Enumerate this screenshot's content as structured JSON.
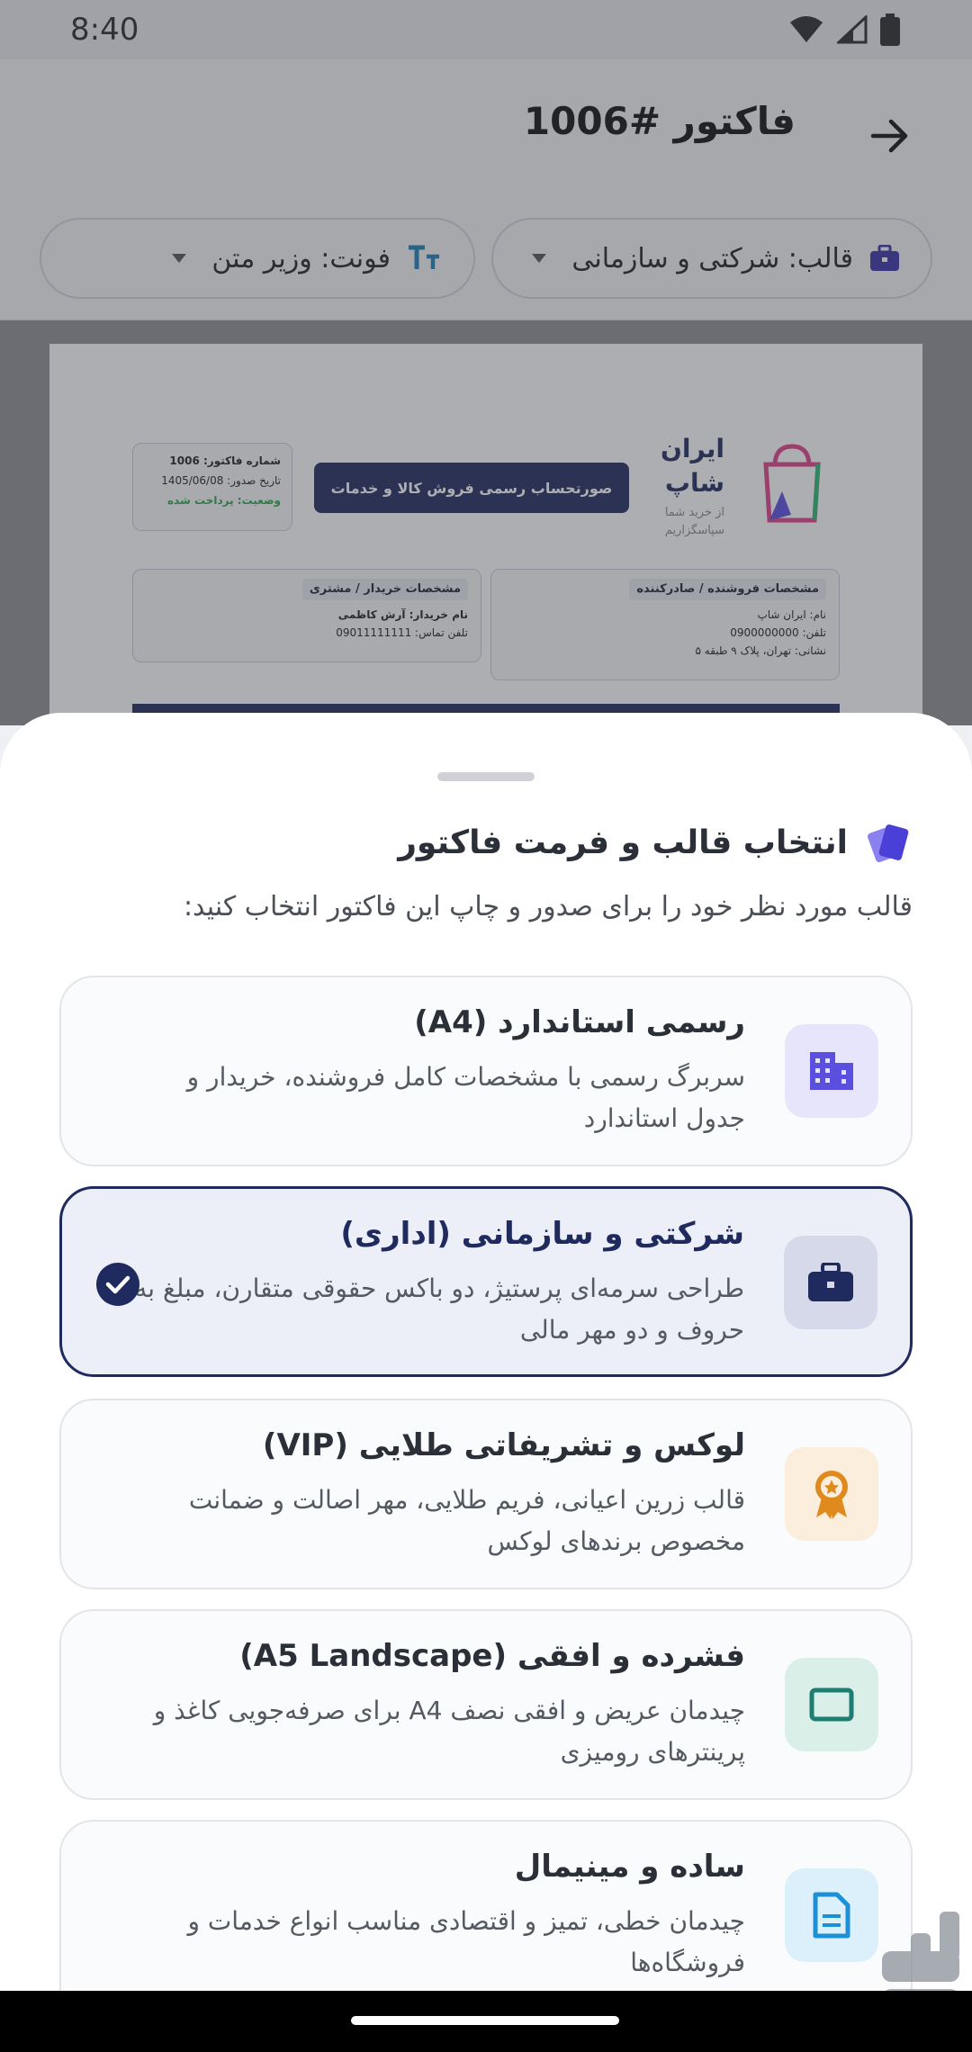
{
  "status": {
    "time": "8:40"
  },
  "app_bar": {
    "title": "فاکتور #1006",
    "template_pill": "قالب: شرکتی و سازمانی",
    "font_pill": "فونت: وزیر متن"
  },
  "preview": {
    "shop_name_1": "ایران",
    "shop_name_2": "شاپ",
    "shop_thanks_1": "از خرید شما",
    "shop_thanks_2": "سپاسگزاریم",
    "banner": "صورتحساب رسمی فروش کالا و خدمات",
    "invoice_number": "شماره فاکتور: 1006",
    "issue_date": "تاریخ صدور: 1405/06/08",
    "status": "وضعیت: پرداخت شده",
    "seller_tag": "مشخصات فروشنده / صادرکننده",
    "seller_name": "نام: ایران شاپ",
    "seller_phone": "تلفن: 0900000000",
    "seller_address": "نشانی: تهران، پلاک ۹ طبقه ۵",
    "buyer_tag": "مشخصات خریدار / مشتری",
    "buyer_name": "نام خریدار: آرش کاظمی",
    "buyer_phone": "تلفن تماس: 09011111111"
  },
  "sheet": {
    "title": "انتخاب قالب و فرمت فاکتور",
    "subtitle": "قالب مورد نظر خود را برای صدور و چاپ این فاکتور انتخاب کنید:",
    "options": [
      {
        "title": "رسمی استاندارد (A4)",
        "desc": "سربرگ رسمی با مشخصات کامل فروشنده، خریدار و جدول استاندارد",
        "icon": "building-icon"
      },
      {
        "title": "شرکتی و سازمانی (اداری)",
        "desc": "طراحی سرمه‌ای پرستیژ، دو باکس حقوقی متقارن، مبلغ به حروف و دو مهر مالی",
        "icon": "briefcase-icon",
        "selected": true
      },
      {
        "title": "لوکس و تشریفاتی طلایی (VIP)",
        "desc": "قالب زرین اعیانی، فریم طلایی، مهر اصالت و ضمانت مخصوص برندهای لوکس",
        "icon": "award-icon"
      },
      {
        "title": "فشرده و افقی (A5 Landscape)",
        "desc": "چیدمان عریض و افقی نصف A4 برای صرفه‌جویی کاغذ و پرینترهای رومیزی",
        "icon": "landscape-icon"
      },
      {
        "title": "ساده و مینیمال",
        "desc": "چیدمان خطی، تمیز و اقتصادی مناسب انواع خدمات و فروشگاه‌ها",
        "icon": "document-icon"
      }
    ]
  },
  "colors": {
    "navy": "#1f2a5e",
    "accent_purple": "#5b4fe0",
    "gold": "#e08a1e",
    "teal": "#1d7f73",
    "sky": "#1d8fd6"
  }
}
